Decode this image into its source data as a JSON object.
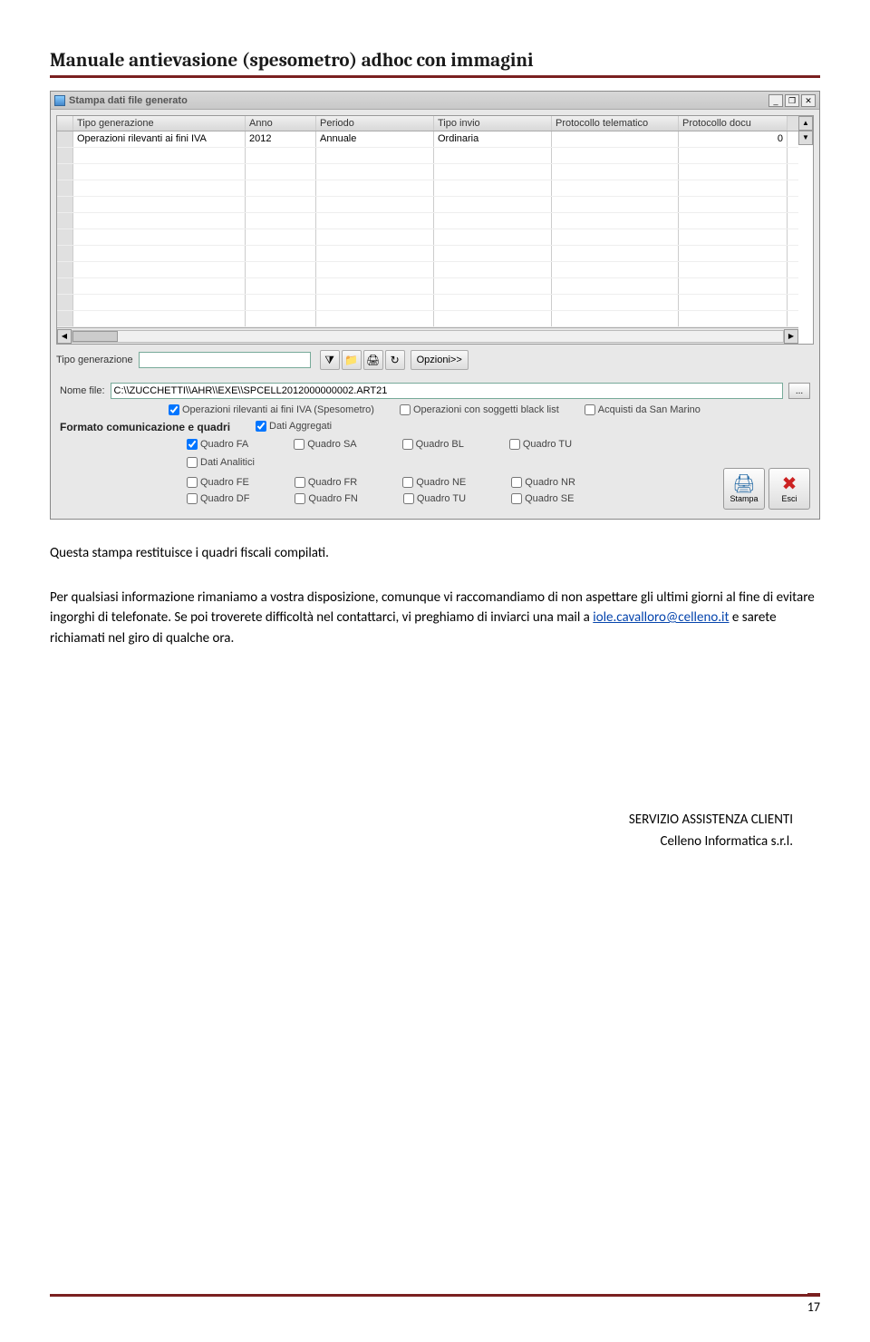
{
  "doc": {
    "title": "Manuale antievasione (spesometro) adhoc con immagini",
    "page_number": "17"
  },
  "window": {
    "title": "Stampa dati file generato",
    "win_min": "_",
    "win_max": "❐",
    "win_close": "✕"
  },
  "grid": {
    "headers": {
      "h1": "Tipo generazione",
      "h2": "Anno",
      "h3": "Periodo",
      "h4": "Tipo invio",
      "h5": "Protocollo telematico",
      "h6": "Protocollo docu"
    },
    "row1": {
      "c1": "Operazioni rilevanti ai fini IVA",
      "c2": "2012",
      "c3": "Annuale",
      "c4": "Ordinaria",
      "c5": "",
      "c6": "0"
    }
  },
  "toolbar": {
    "label_tipogen": "Tipo generazione",
    "opzioni": "Opzioni>>"
  },
  "form": {
    "nomefile_label": "Nome file:",
    "nomefile_value": "C:\\\\ZUCCHETTI\\\\AHR\\\\EXE\\\\SPCELL2012000000002.ART21",
    "dots": "...",
    "chk_spesometro": "Operazioni rilevanti ai fini IVA (Spesometro)",
    "chk_blacklist": "Operazioni con soggetti black list",
    "chk_sanmarino": "Acquisti da San Marino",
    "section_label": "Formato comunicazione e quadri",
    "chk_aggregati": "Dati Aggregati",
    "q_fa": "Quadro FA",
    "q_sa": "Quadro SA",
    "q_bl": "Quadro BL",
    "q_tu": "Quadro TU",
    "chk_analitici": "Dati Analitici",
    "q_fe": "Quadro FE",
    "q_fr": "Quadro FR",
    "q_ne": "Quadro NE",
    "q_nr": "Quadro NR",
    "q_df": "Quadro DF",
    "q_fn": "Quadro FN",
    "q_tu2": "Quadro TU",
    "q_se": "Quadro SE",
    "btn_stampa": "Stampa",
    "btn_esci": "Esci"
  },
  "body": {
    "p1": "Questa stampa restituisce i quadri fiscali compilati.",
    "p2a": "Per qualsiasi informazione rimaniamo a vostra disposizione,  comunque vi raccomandiamo di non aspettare gli ultimi giorni al fine di evitare ingorghi di telefonate. Se poi troverete difficoltà nel contattarci, vi preghiamo di inviarci una mail a ",
    "p2link": "iole.cavalloro@celleno.it",
    "p2b": " e sarete richiamati nel giro di qualche ora."
  },
  "signature": {
    "l1": "SERVIZIO ASSISTENZA CLIENTI",
    "l2": "Celleno Informatica s.r.l."
  }
}
